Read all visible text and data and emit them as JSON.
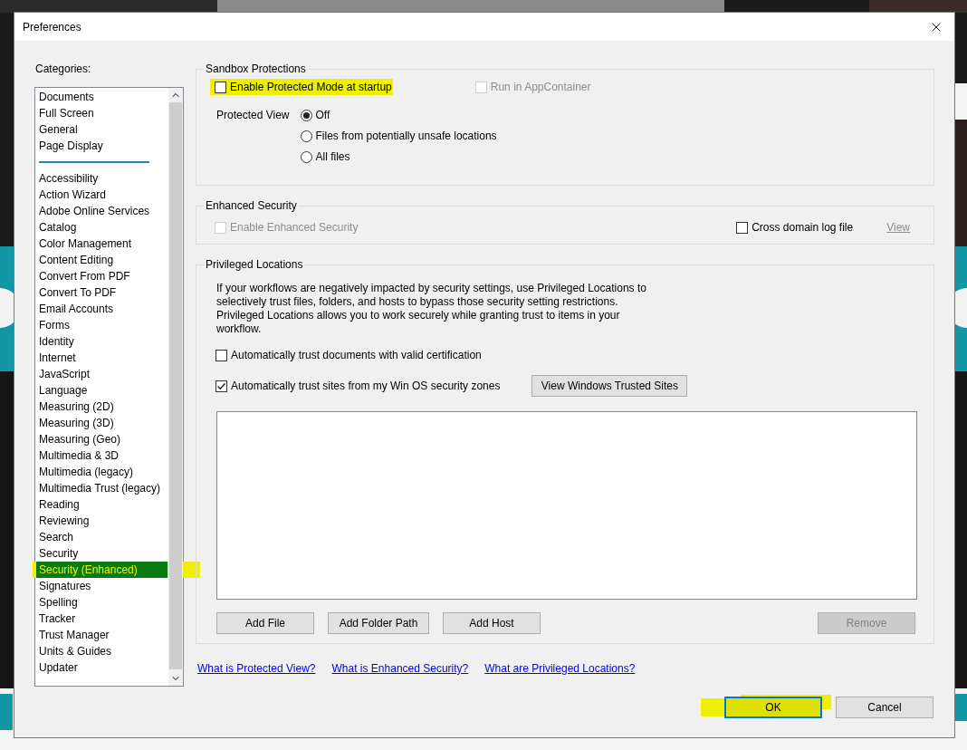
{
  "window": {
    "title": "Preferences"
  },
  "categories": {
    "label": "Categories:",
    "groups": [
      [
        {
          "label": "Documents",
          "selected": false,
          "highlighted": false
        },
        {
          "label": "Full Screen",
          "selected": false,
          "highlighted": false
        },
        {
          "label": "General",
          "selected": false,
          "highlighted": false
        },
        {
          "label": "Page Display",
          "selected": false,
          "highlighted": false
        }
      ],
      [
        {
          "label": "Accessibility",
          "selected": false,
          "highlighted": false
        },
        {
          "label": "Action Wizard",
          "selected": false,
          "highlighted": false
        },
        {
          "label": "Adobe Online Services",
          "selected": false,
          "highlighted": false
        },
        {
          "label": "Catalog",
          "selected": false,
          "highlighted": false
        },
        {
          "label": "Color Management",
          "selected": false,
          "highlighted": false
        },
        {
          "label": "Content Editing",
          "selected": false,
          "highlighted": false
        },
        {
          "label": "Convert From PDF",
          "selected": false,
          "highlighted": false
        },
        {
          "label": "Convert To PDF",
          "selected": false,
          "highlighted": false
        },
        {
          "label": "Email Accounts",
          "selected": false,
          "highlighted": false
        },
        {
          "label": "Forms",
          "selected": false,
          "highlighted": false
        },
        {
          "label": "Identity",
          "selected": false,
          "highlighted": false
        },
        {
          "label": "Internet",
          "selected": false,
          "highlighted": false
        },
        {
          "label": "JavaScript",
          "selected": false,
          "highlighted": false
        },
        {
          "label": "Language",
          "selected": false,
          "highlighted": false
        },
        {
          "label": "Measuring (2D)",
          "selected": false,
          "highlighted": false
        },
        {
          "label": "Measuring (3D)",
          "selected": false,
          "highlighted": false
        },
        {
          "label": "Measuring (Geo)",
          "selected": false,
          "highlighted": false
        },
        {
          "label": "Multimedia & 3D",
          "selected": false,
          "highlighted": false
        },
        {
          "label": "Multimedia (legacy)",
          "selected": false,
          "highlighted": false
        },
        {
          "label": "Multimedia Trust (legacy)",
          "selected": false,
          "highlighted": false
        },
        {
          "label": "Reading",
          "selected": false,
          "highlighted": false
        },
        {
          "label": "Reviewing",
          "selected": false,
          "highlighted": false
        },
        {
          "label": "Search",
          "selected": false,
          "highlighted": false
        },
        {
          "label": "Security",
          "selected": false,
          "highlighted": false
        },
        {
          "label": "Security (Enhanced)",
          "selected": true,
          "highlighted": true
        },
        {
          "label": "Signatures",
          "selected": false,
          "highlighted": false
        },
        {
          "label": "Spelling",
          "selected": false,
          "highlighted": false
        },
        {
          "label": "Tracker",
          "selected": false,
          "highlighted": false
        },
        {
          "label": "Trust Manager",
          "selected": false,
          "highlighted": false
        },
        {
          "label": "Units & Guides",
          "selected": false,
          "highlighted": false
        },
        {
          "label": "Updater",
          "selected": false,
          "highlighted": false
        }
      ]
    ]
  },
  "sandbox": {
    "title": "Sandbox Protections",
    "options": [
      {
        "label": "Enable Protected Mode at startup",
        "checked": false,
        "disabled": false,
        "highlighted": true
      },
      {
        "label": "Run in AppContainer",
        "checked": false,
        "disabled": true,
        "highlighted": false
      }
    ],
    "protected_view": {
      "label": "Protected View",
      "choices": [
        {
          "label": "Off",
          "selected": true
        },
        {
          "label": "Files from potentially unsafe locations",
          "selected": false
        },
        {
          "label": "All files",
          "selected": false
        }
      ]
    }
  },
  "enhanced": {
    "title": "Enhanced Security",
    "options": [
      {
        "label": "Enable Enhanced Security",
        "checked": false,
        "disabled": true
      },
      {
        "label": "Cross domain log file",
        "checked": false,
        "disabled": false
      }
    ],
    "view_link": {
      "label": "View",
      "disabled": true
    }
  },
  "privileged": {
    "title": "Privileged Locations",
    "description": "If your workflows are negatively impacted by security settings, use Privileged Locations to selectively trust files, folders, and hosts to bypass those security setting restrictions. Privileged Locations allows you to work securely while granting trust to items in your workflow.",
    "options": [
      {
        "label": "Automatically trust documents with valid certification",
        "checked": false,
        "disabled": false
      },
      {
        "label": "Automatically trust sites from my Win OS security zones",
        "checked": true,
        "disabled": false
      }
    ],
    "trusted_sites_button": "View Windows Trusted Sites",
    "buttons": [
      {
        "label": "Add File",
        "disabled": false
      },
      {
        "label": "Add Folder Path",
        "disabled": false
      },
      {
        "label": "Add Host",
        "disabled": false
      },
      {
        "label": "Remove",
        "disabled": true
      }
    ]
  },
  "help_links": [
    "What is Protected View?",
    "What is Enhanced Security?",
    "What are Privileged Locations?"
  ],
  "footer_buttons": [
    {
      "label": "OK",
      "default": true,
      "highlighted": true
    },
    {
      "label": "Cancel",
      "default": false,
      "highlighted": false
    }
  ]
}
